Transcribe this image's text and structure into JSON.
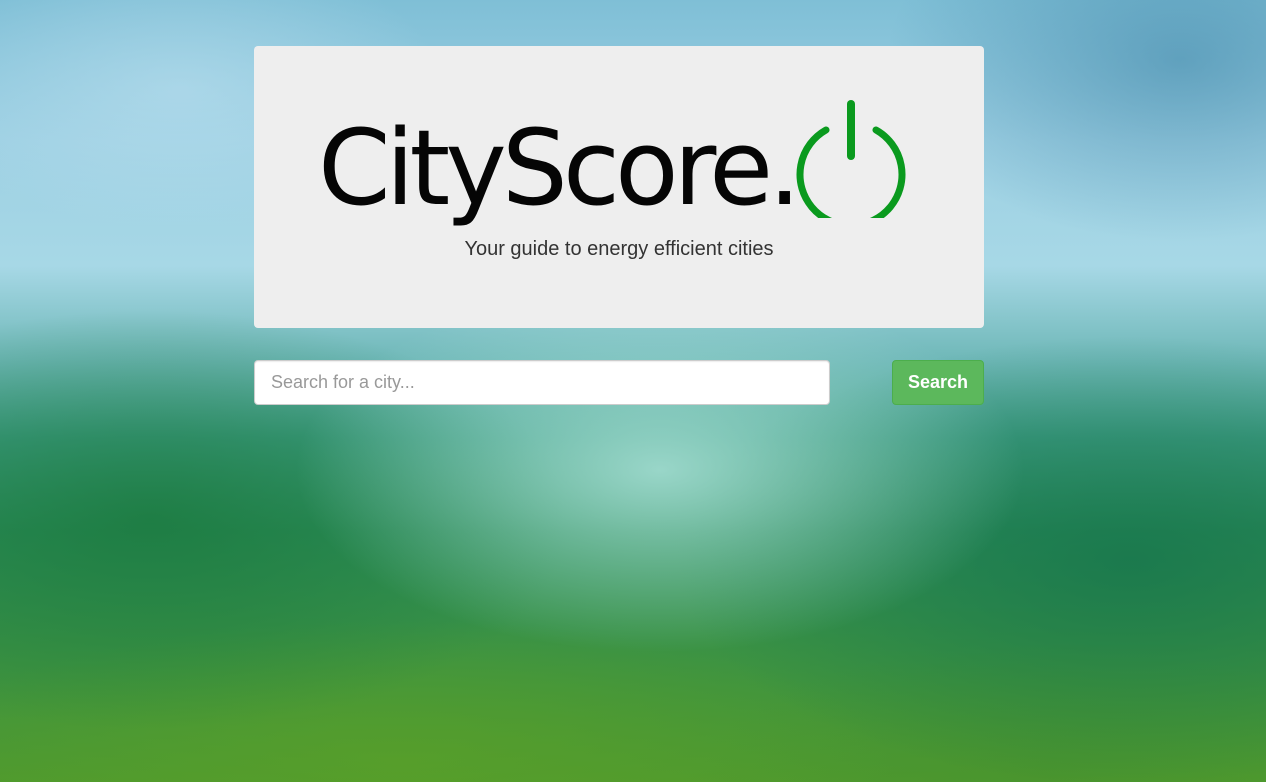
{
  "hero": {
    "logo_text": "CityScore.",
    "logo_icon": "power-icon",
    "tagline": "Your guide to energy efficient cities"
  },
  "search": {
    "placeholder": "Search for a city...",
    "value": "",
    "button_label": "Search"
  },
  "colors": {
    "brand_green": "#0a9a1e",
    "button_green": "#5cb85c",
    "hero_background": "#eeeeee"
  }
}
